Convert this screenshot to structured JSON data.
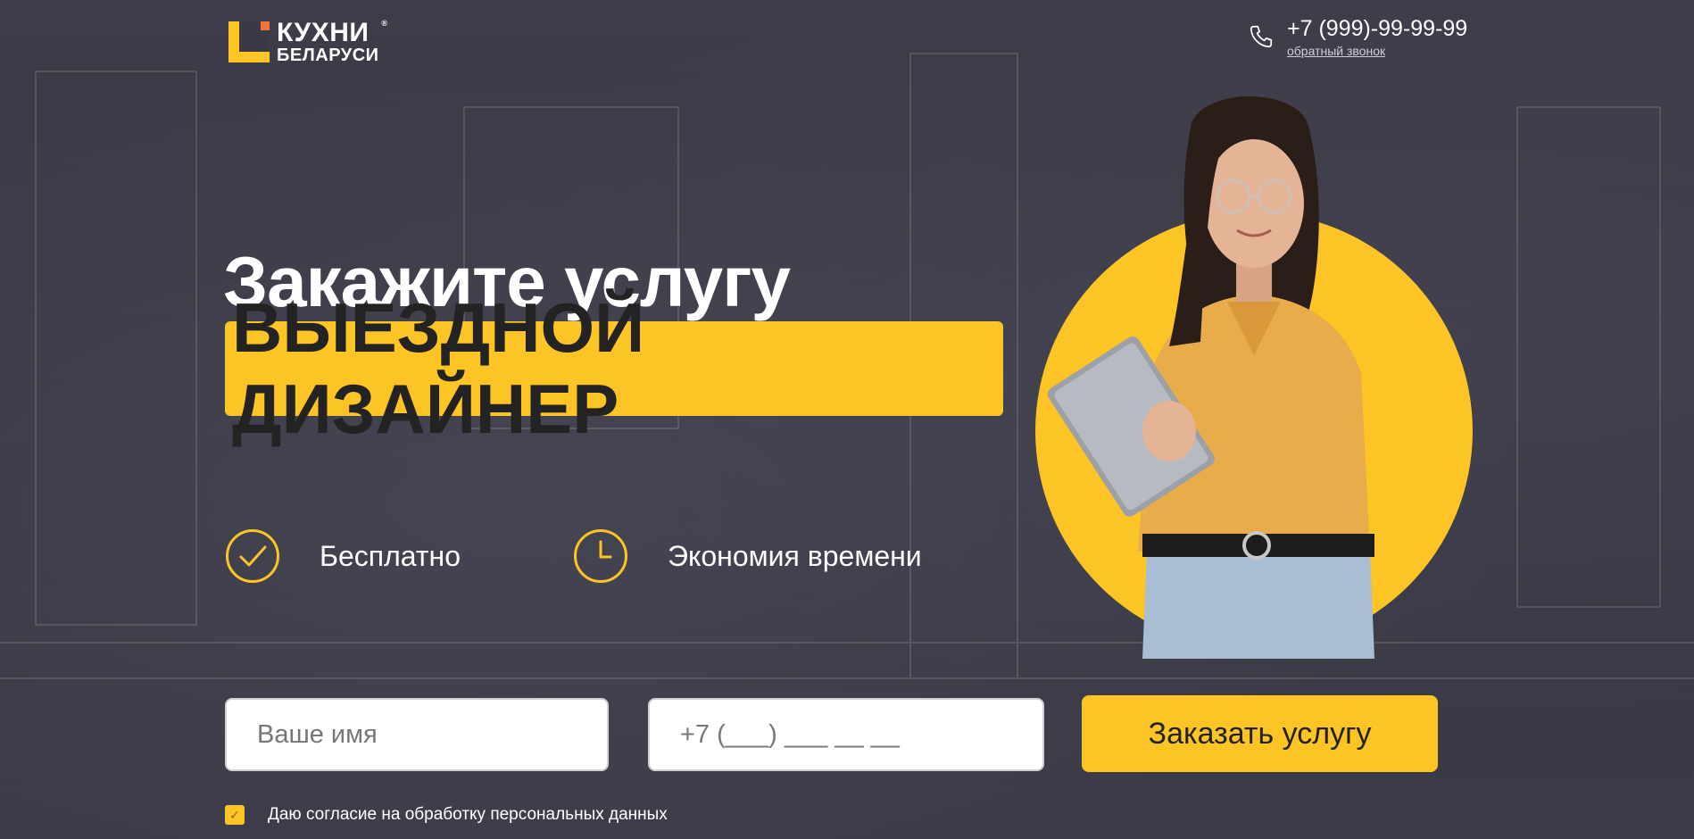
{
  "header": {
    "logo": {
      "line1": "КУХНИ",
      "registered": "®",
      "line2": "БЕЛАРУСИ"
    },
    "phone": "+7 (999)-99-99-99",
    "callback": "обратный звонок",
    "phone_icon": "phone-icon"
  },
  "hero": {
    "headline": "Закажите услугу",
    "highlight": "ВЫЕЗДНОЙ ДИЗАЙНЕР"
  },
  "features": [
    {
      "icon": "check-circle-icon",
      "label": "Бесплатно"
    },
    {
      "icon": "clock-icon",
      "label": "Экономия времени"
    }
  ],
  "form": {
    "name_placeholder": "Ваше имя",
    "phone_placeholder": "+7 (___) ___ __ __",
    "submit_label": "Заказать услугу",
    "consent_label": "Даю согласие на обработку персональных данных",
    "consent_checked": true
  },
  "colors": {
    "accent": "#fcc425",
    "background": "#3a3946",
    "text_dark": "#232323",
    "shirt": "#e8ad4a"
  }
}
